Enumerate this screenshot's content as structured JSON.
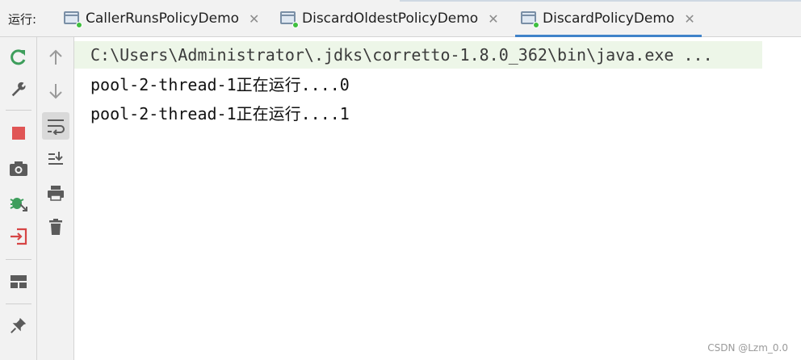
{
  "run_label": "运行:",
  "tabs": [
    {
      "label": "CallerRunsPolicyDemo",
      "close": "✕",
      "active": false
    },
    {
      "label": "DiscardOldestPolicyDemo",
      "close": "✕",
      "active": false
    },
    {
      "label": "DiscardPolicyDemo",
      "close": "✕",
      "active": true
    }
  ],
  "left_toolbar": [
    "rerun-icon",
    "wrench-icon",
    "stop-icon",
    "camera-icon",
    "debug-icon",
    "exit-icon",
    "layout-icon",
    "pin-icon"
  ],
  "second_toolbar": [
    "arrow-up-icon",
    "arrow-down-icon",
    "soft-wrap-icon",
    "scroll-to-end-icon",
    "print-icon",
    "trash-icon"
  ],
  "console": {
    "command": "C:\\Users\\Administrator\\.jdks\\corretto-1.8.0_362\\bin\\java.exe ...",
    "lines": [
      "pool-2-thread-1正在运行....0",
      "pool-2-thread-1正在运行....1"
    ]
  },
  "watermark": "CSDN @Lzm_0.0",
  "colors": {
    "accent": "#4083c9",
    "command_bg": "#edf6e8",
    "run_green": "#3fbf3f",
    "stop_red": "#e05555"
  }
}
